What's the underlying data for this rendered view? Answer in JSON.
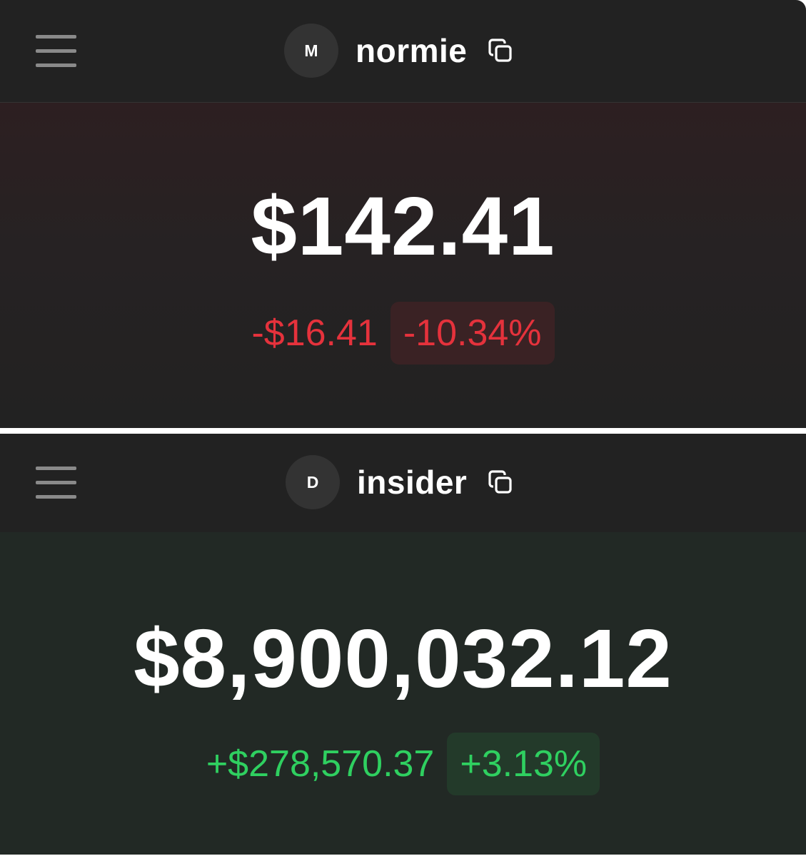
{
  "accounts": [
    {
      "avatar_letter": "M",
      "username": "normie",
      "balance": "$142.41",
      "change_amount": "-$16.41",
      "change_percent": "-10.34%",
      "trend": "down",
      "trend_color": "#e5323c"
    },
    {
      "avatar_letter": "D",
      "username": "insider",
      "balance": "$8,900,032.12",
      "change_amount": "+$278,570.37",
      "change_percent": "+3.13%",
      "trend": "up",
      "trend_color": "#2fd060"
    }
  ],
  "icons": {
    "menu": "hamburger-menu-icon",
    "copy": "copy-icon"
  }
}
